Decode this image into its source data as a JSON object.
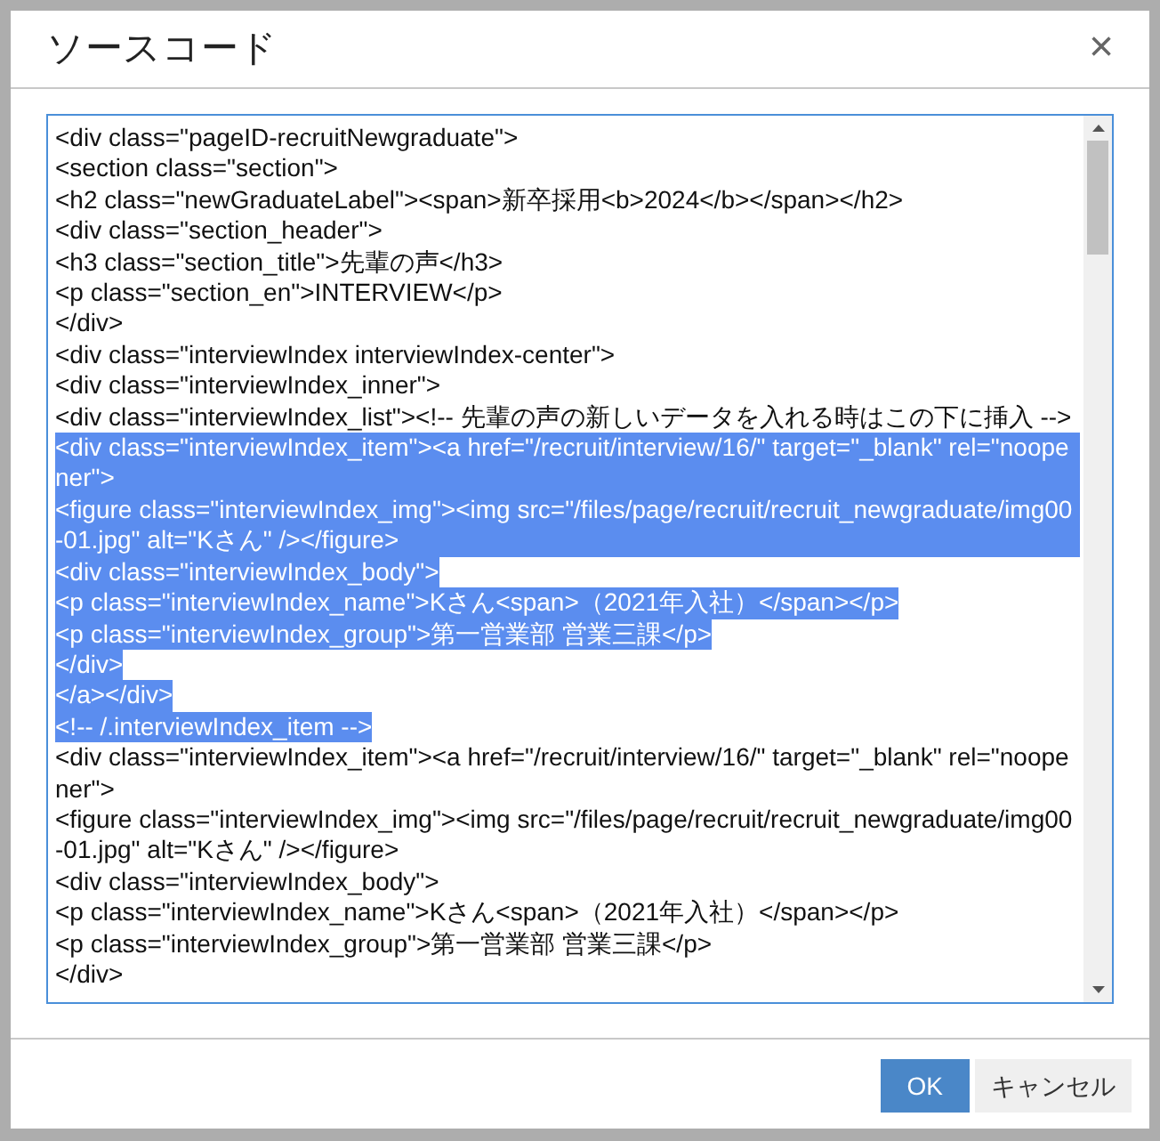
{
  "dialog": {
    "title": "ソースコード",
    "close": "×"
  },
  "code_lines": [
    {
      "text": "<div class=\"pageID-recruitNewgraduate\">",
      "selected": false
    },
    {
      "text": "<section class=\"section\">",
      "selected": false
    },
    {
      "text": "<h2 class=\"newGraduateLabel\"><span>新卒採用<b>2024</b></span></h2>",
      "selected": false
    },
    {
      "text": "<div class=\"section_header\">",
      "selected": false
    },
    {
      "text": "<h3 class=\"section_title\">先輩の声</h3>",
      "selected": false
    },
    {
      "text": "<p class=\"section_en\">INTERVIEW</p>",
      "selected": false
    },
    {
      "text": "</div>",
      "selected": false
    },
    {
      "text": "<div class=\"interviewIndex interviewIndex-center\">",
      "selected": false
    },
    {
      "text": "<div class=\"interviewIndex_inner\">",
      "selected": false
    },
    {
      "text": "<div class=\"interviewIndex_list\"><!-- 先輩の声の新しいデータを入れる時はこの下に挿入 -->",
      "selected": false
    },
    {
      "text": "<div class=\"interviewIndex_item\"><a href=\"/recruit/interview/16/\" target=\"_blank\" rel=\"noopener\">",
      "selected": true
    },
    {
      "text": "<figure class=\"interviewIndex_img\"><img src=\"/files/page/recruit/recruit_newgraduate/img00-01.jpg\" alt=\"Kさん\" /></figure>",
      "selected": true
    },
    {
      "text": "<div class=\"interviewIndex_body\">",
      "selected": true
    },
    {
      "text": "<p class=\"interviewIndex_name\">Kさん<span>（2021年入社）</span></p>",
      "selected": true
    },
    {
      "text": "<p class=\"interviewIndex_group\">第一営業部 営業三課</p>",
      "selected": true
    },
    {
      "text": "</div>",
      "selected": true
    },
    {
      "text": "</a></div>",
      "selected": true
    },
    {
      "text": "<!-- /.interviewIndex_item -->",
      "selected": true
    },
    {
      "text": "<div class=\"interviewIndex_item\"><a href=\"/recruit/interview/16/\" target=\"_blank\" rel=\"noopener\">",
      "selected": false
    },
    {
      "text": "<figure class=\"interviewIndex_img\"><img src=\"/files/page/recruit/recruit_newgraduate/img00-01.jpg\" alt=\"Kさん\" /></figure>",
      "selected": false
    },
    {
      "text": "<div class=\"interviewIndex_body\">",
      "selected": false
    },
    {
      "text": "<p class=\"interviewIndex_name\">Kさん<span>（2021年入社）</span></p>",
      "selected": false
    },
    {
      "text": "<p class=\"interviewIndex_group\">第一営業部 営業三課</p>",
      "selected": false
    },
    {
      "text": "</div>",
      "selected": false
    }
  ],
  "buttons": [
    {
      "label": "OK",
      "kind": "primary"
    },
    {
      "label": "キャンセル",
      "kind": "secondary"
    }
  ]
}
